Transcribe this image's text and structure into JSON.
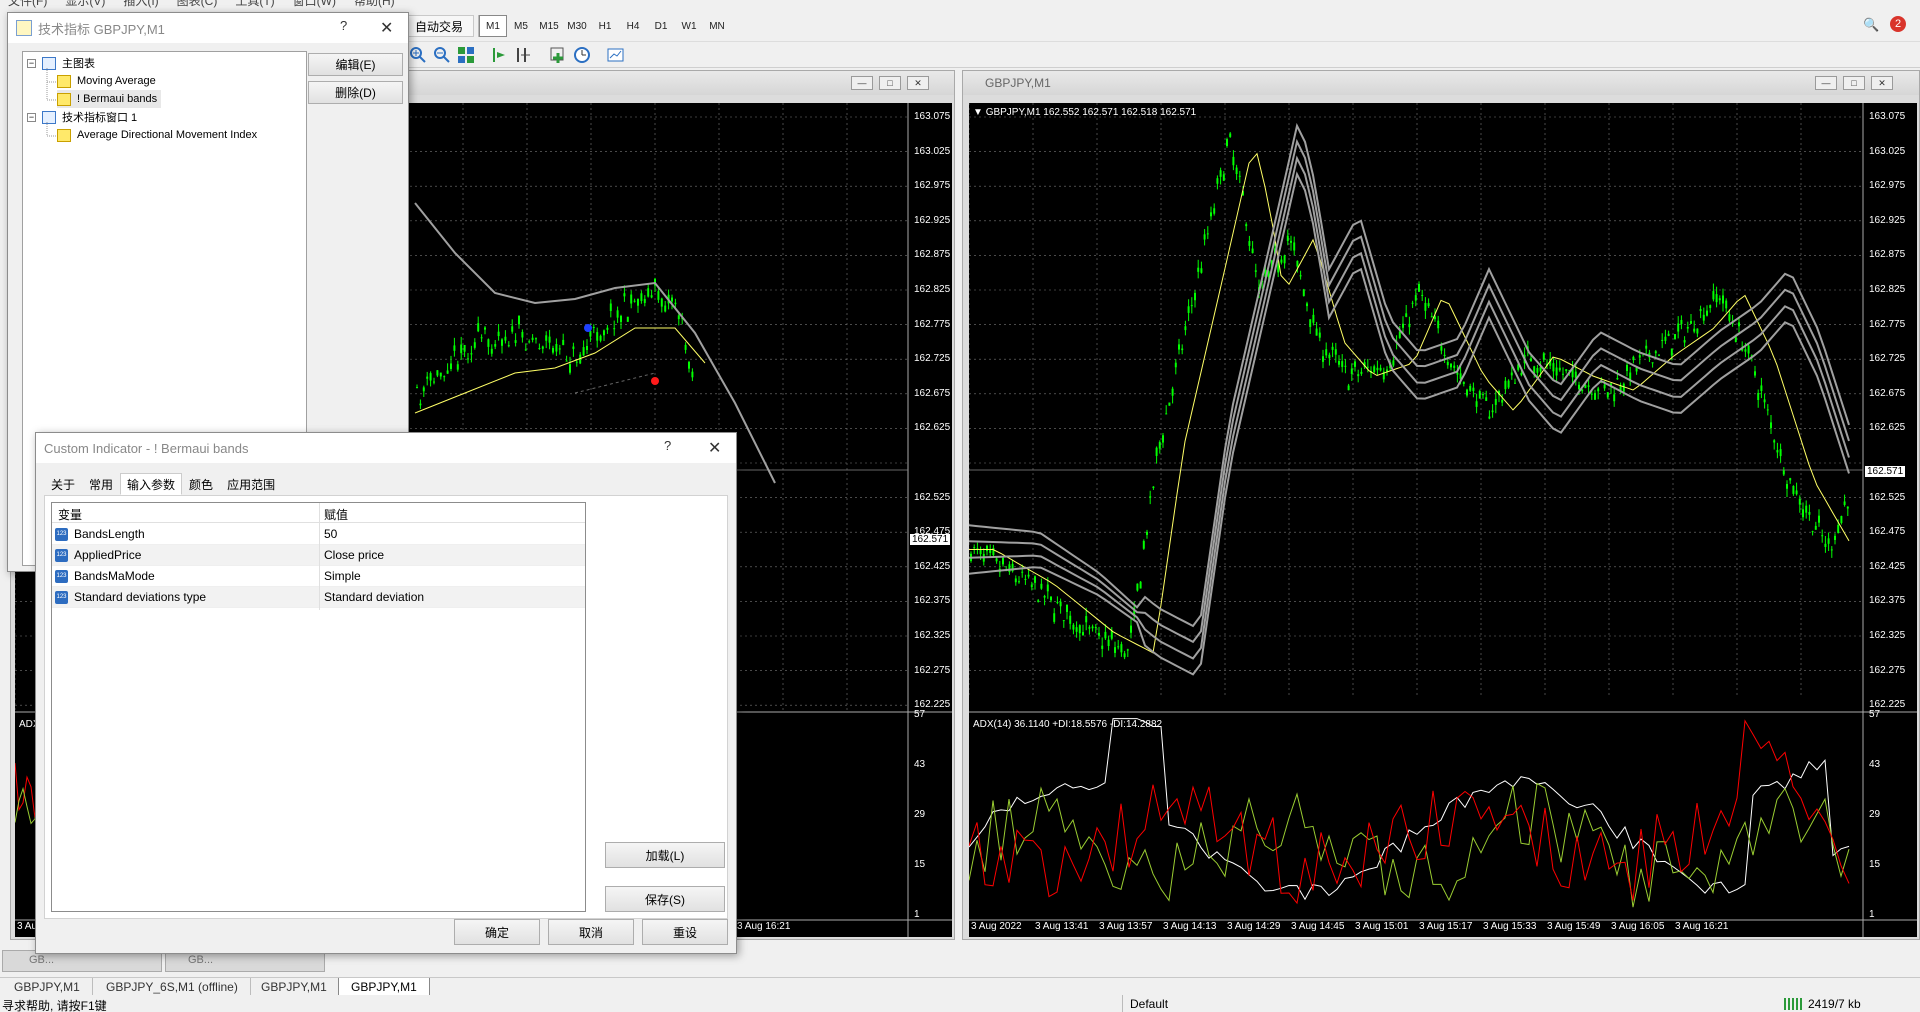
{
  "menu": [
    "文件(F)",
    "显示(V)",
    "插入(I)",
    "图表(C)",
    "工具(T)",
    "窗口(W)",
    "帮助(H)"
  ],
  "toolbar": {
    "auto_trade_label": "自动交易",
    "timeframes": [
      "M1",
      "M5",
      "M15",
      "M30",
      "H1",
      "H4",
      "D1",
      "W1",
      "MN"
    ],
    "notification_count": "2"
  },
  "indicators_dialog": {
    "title": "技术指标 GBPJPY,M1",
    "help": "?",
    "close": "✕",
    "tree": [
      {
        "label": "主图表",
        "level": 0
      },
      {
        "label": "Moving Average",
        "level": 1
      },
      {
        "label": "! Bermaui bands",
        "level": 1
      },
      {
        "label": "技术指标窗口 1",
        "level": 0
      },
      {
        "label": "Average Directional Movement Index",
        "level": 1
      }
    ],
    "edit_button": "编辑(E)",
    "delete_button": "删除(D)"
  },
  "custom_dialog": {
    "title": "Custom Indicator - ! Bermaui bands",
    "help": "?",
    "close": "✕",
    "tabs": [
      "关于",
      "常用",
      "输入参数",
      "颜色",
      "应用范围"
    ],
    "active_tab": "输入参数",
    "grid_headers": [
      "变量",
      "赋值"
    ],
    "params": [
      {
        "name": "BandsLength",
        "value": "50"
      },
      {
        "name": "AppliedPrice",
        "value": "Close price"
      },
      {
        "name": "BandsMaMode",
        "value": "Simple"
      },
      {
        "name": "Standard deviations type",
        "value": "Standard deviation"
      }
    ],
    "load_button": "加载(L)",
    "save_button": "保存(S)",
    "ok_button": "确定",
    "cancel_button": "取消",
    "reset_button": "重设"
  },
  "right_chart": {
    "window_title": "GBPJPY,M1",
    "info_line": "GBPJPY,M1  162.552 162.571 162.518 162.571",
    "price_ticks": [
      "163.075",
      "163.025",
      "162.975",
      "162.925",
      "162.875",
      "162.825",
      "162.775",
      "162.725",
      "162.675",
      "162.625",
      "162.571",
      "162.525",
      "162.475",
      "162.425",
      "162.375",
      "162.325",
      "162.275",
      "162.225"
    ],
    "current_price": "162.571",
    "adx_label": "ADX(14) 36.1140 +DI:18.5576 -DI:14.2882",
    "adx_ticks": [
      "57",
      "43",
      "29",
      "15",
      "1"
    ],
    "time_ticks": [
      "3 Aug 2022",
      "3 Aug 13:41",
      "3 Aug 13:57",
      "3 Aug 14:13",
      "3 Aug 14:29",
      "3 Aug 14:45",
      "3 Aug 15:01",
      "3 Aug 15:17",
      "3 Aug 15:33",
      "3 Aug 15:49",
      "3 Aug 16:05",
      "3 Aug 16:21"
    ]
  },
  "left_chart": {
    "adx_label": "ADX",
    "time_first": "3 Au",
    "time_last": "3 Aug 16:21",
    "current_price": "162.571"
  },
  "bottom_tabs": [
    "GBPJPY,M1",
    "GBPJPY_6S,M1 (offline)",
    "GBPJPY,M1",
    "GBPJPY,M1"
  ],
  "minimized_labels": [
    "GB...",
    "GB..."
  ],
  "status": {
    "help_text": "寻求帮助, 请按F1键",
    "profile": "Default",
    "traffic": "2419/7 kb"
  },
  "colors": {
    "chart_bg": "#000000",
    "candle": "#00ff00",
    "adx_main": "#ffffff",
    "plus_di": "#9acd32",
    "minus_di": "#ff0000",
    "bands": "#a0a0a0",
    "ma": "#ffff66"
  }
}
